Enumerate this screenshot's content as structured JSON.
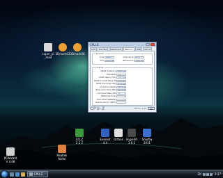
{
  "desktop_icons": [
    {
      "label": "super_pi\n_mod",
      "color": "#d9d9d9"
    },
    {
      "label": "3Dmark03",
      "color": "#f0a030"
    },
    {
      "label": "3Dmark06",
      "color": "#f0a030"
    },
    {
      "label": "CCLZ\n2.1.2",
      "color": "#3a9a3a"
    },
    {
      "label": "Everest\n4.4",
      "color": "#3060c0"
    },
    {
      "label": "Orthos",
      "color": "#e0e0e0"
    },
    {
      "label": "HyperPI\n1.0.1",
      "color": "#4a4a4a"
    },
    {
      "label": "SiSoftw\n2011",
      "color": "#3a70d0"
    },
    {
      "label": "PCWizard\nV 4.08",
      "color": "#d0d0d0"
    },
    {
      "label": "Realtek\nfolder",
      "color": "#e08040"
    }
  ],
  "cpuz": {
    "title": "CPU-Z",
    "tabs": [
      "CPU",
      "Caches",
      "Mainboard",
      "Memory",
      "SPD",
      "About"
    ],
    "active_tab": "Memory",
    "general_group": "General",
    "general_rows": [
      {
        "k": "Type",
        "v": "DDR3"
      },
      {
        "k": "Size",
        "v": "4096 MBytes"
      },
      {
        "k": "Channels #",
        "v": "Dual"
      },
      {
        "k": "NB Frequency",
        "v": "1666.5 MHz"
      }
    ],
    "timings_group": "Timings",
    "timing_rows": [
      {
        "k": "DRAM Frequency",
        "v": "833.2 MHz"
      },
      {
        "k": "FSB:DRAM",
        "v": "1:4"
      },
      {
        "k": "CAS# Latency (CL)",
        "v": "7.0 clocks"
      },
      {
        "k": "RAS# to CAS# Delay (tRCD)",
        "v": "7 clocks"
      },
      {
        "k": "RAS# Precharge (tRP)",
        "v": "7 clocks"
      },
      {
        "k": "Cycle Time (tRAS)",
        "v": "20 clocks"
      },
      {
        "k": "Bank Cycle Time (tRC)",
        "v": "27 clocks"
      },
      {
        "k": "Command Rate (CR)",
        "v": "1T"
      },
      {
        "k": "DRAM Idle Timer",
        "v": ""
      },
      {
        "k": "Total CAS# (tRDRAM)",
        "v": ""
      },
      {
        "k": "Row To Column (tRCD)",
        "v": ""
      }
    ],
    "brand": "CPU-Z",
    "version": "Version 1.55",
    "ok_label": "OK"
  },
  "taskbar": {
    "task_label": "CPU-Z",
    "lang": "EN",
    "clock": "2:27"
  }
}
